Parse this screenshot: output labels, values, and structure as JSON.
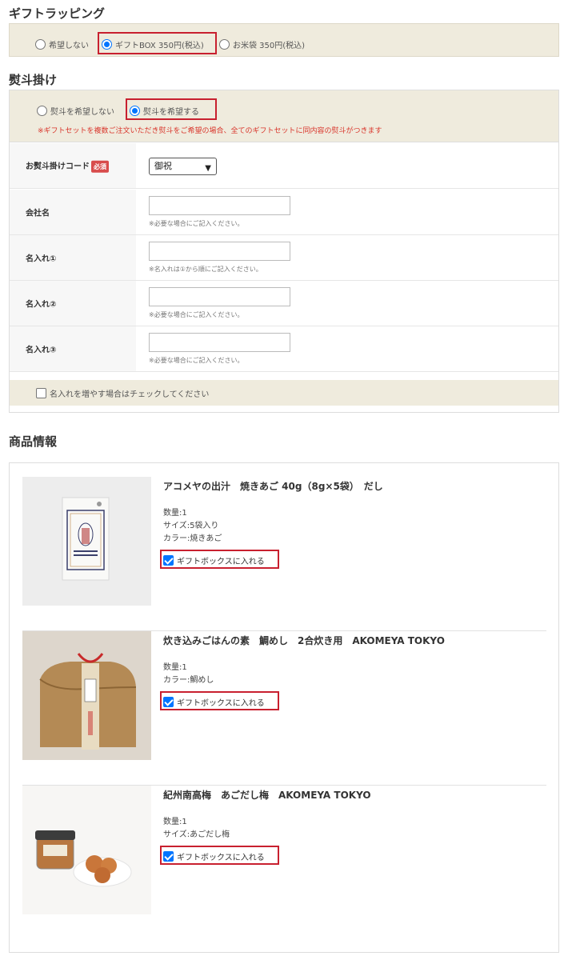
{
  "wrapping": {
    "title": "ギフトラッピング",
    "options": [
      {
        "label": "希望しない",
        "selected": false
      },
      {
        "label": "ギフトBOX 350円(税込)",
        "selected": true
      },
      {
        "label": "お米袋 350円(税込)",
        "selected": false
      }
    ]
  },
  "noshi": {
    "title": "熨斗掛け",
    "options": [
      {
        "label": "熨斗を希望しない",
        "selected": false
      },
      {
        "label": "熨斗を希望する",
        "selected": true
      }
    ],
    "note": "※ギフトセットを複数ご注文いただき熨斗をご希望の場合、全てのギフトセットに同内容の熨斗がつきます",
    "code_label": "お熨斗掛けコード",
    "required_badge": "必須",
    "code_value": "御祝",
    "fields": [
      {
        "label": "会社名",
        "value": "",
        "hint": "※必要な場合にご記入ください。"
      },
      {
        "label": "名入れ①",
        "value": "",
        "hint": "※名入れは①から順にご記入ください。"
      },
      {
        "label": "名入れ②",
        "value": "",
        "hint": "※必要な場合にご記入ください。"
      },
      {
        "label": "名入れ③",
        "value": "",
        "hint": "※必要な場合にご記入ください。"
      }
    ],
    "more_names_label": "名入れを増やす場合はチェックしてください",
    "more_names_checked": false
  },
  "products": {
    "title": "商品情報",
    "gift_box_label": "ギフトボックスに入れる",
    "items": [
      {
        "name": "アコメヤの出汁　焼きあご 40g（8g×5袋）　だし",
        "attrs": [
          "数量:1",
          "サイズ:5袋入り",
          "カラー:焼きあご"
        ],
        "gift_box": true
      },
      {
        "name": "炊き込みごはんの素　鯛めし　2合炊き用　AKOMEYA TOKYO",
        "attrs": [
          "数量:1",
          "カラー:鯛めし"
        ],
        "gift_box": true
      },
      {
        "name": "紀州南高梅　あごだし梅　AKOMEYA TOKYO",
        "attrs": [
          "数量:1",
          "サイズ:あごだし梅"
        ],
        "gift_box": true
      }
    ]
  },
  "colors": {
    "accent": "#0075ff",
    "highlight": "#c8202f",
    "note": "#d9352b",
    "panel": "#efebdd"
  }
}
